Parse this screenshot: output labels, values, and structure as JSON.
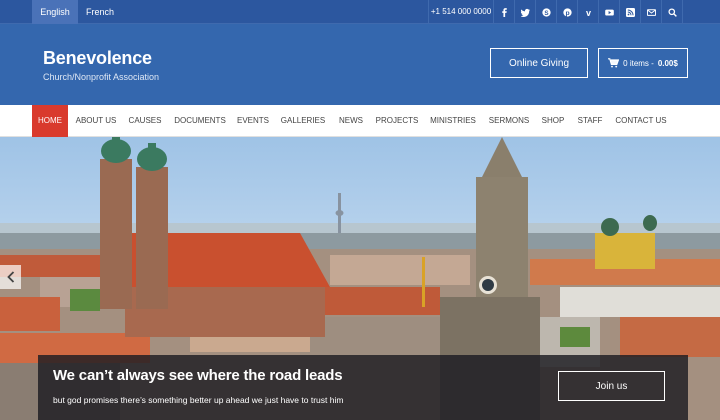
{
  "topbar": {
    "languages": [
      "English",
      "French"
    ],
    "phone": "+1 514 000 0000",
    "social_icons": [
      "facebook-icon",
      "twitter-icon",
      "skype-icon",
      "pinterest-icon",
      "vimeo-icon",
      "youtube-icon",
      "rss-icon",
      "email-icon",
      "search-icon"
    ]
  },
  "header": {
    "site_title": "Benevolence",
    "tagline": "Church/Nonprofit Association",
    "giving_label": "Online Giving",
    "cart_label": "0 items -",
    "cart_total": "0.00$"
  },
  "nav": {
    "items": [
      "HOME",
      "ABOUT US",
      "CAUSES",
      "DOCUMENTS",
      "EVENTS",
      "GALLERIES",
      "NEWS",
      "PROJECTS",
      "MINISTRIES",
      "SERMONS",
      "SHOP",
      "STAFF",
      "CONTACT US"
    ],
    "active": "HOME"
  },
  "hero": {
    "title": "We can’t always see where the road leads",
    "subtitle": "but god promises there’s something better up ahead we just have to trust him",
    "button_label": "Join us"
  },
  "colors": {
    "topbar": "#2c579f",
    "header": "#3467ae",
    "nav_active": "#d93a2d"
  }
}
